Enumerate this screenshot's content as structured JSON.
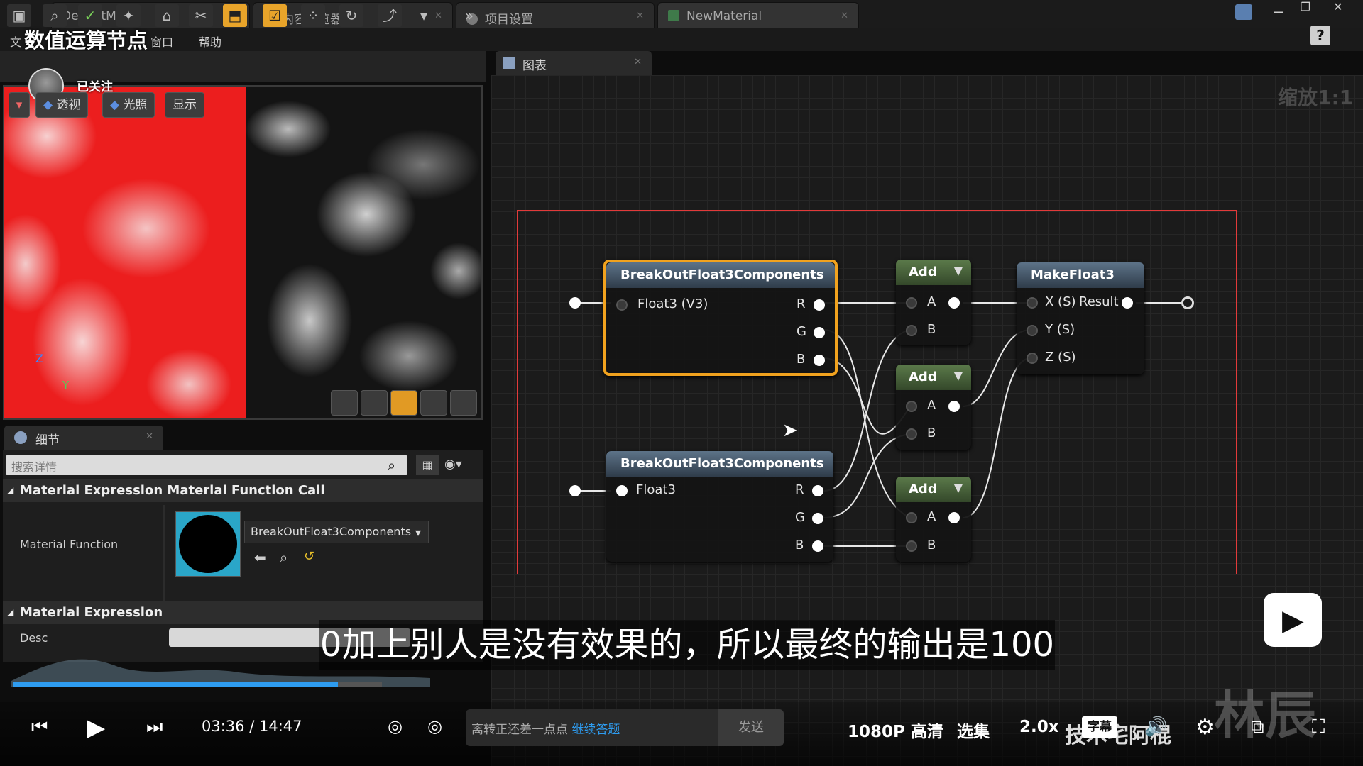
{
  "app": {
    "logo": "u"
  },
  "tabs": [
    {
      "label": "DefaultMap"
    },
    {
      "label": "内容浏览器"
    },
    {
      "label": "项目设置"
    },
    {
      "label": "NewMaterial"
    }
  ],
  "menu": {
    "file": "文",
    "window": "窗口",
    "help": "帮助"
  },
  "video": {
    "title": "数值运算节点",
    "followed": "已关注",
    "subtitle": "0加上别人是没有效果的，所以最终的输出是100",
    "current_time": "03:36",
    "separator": "/",
    "total_time": "14:47",
    "progress": 0.243,
    "danmu_prompt": "离转正还差一点点",
    "danmu_link": "继续答题",
    "send": "发送",
    "quality": "1080P 高清",
    "episodes": "选集",
    "speed": "2.0x",
    "subtitles_btn": "字幕",
    "uploader_text": "技术宅阿棍",
    "watermark": "林辰"
  },
  "viewport": {
    "buttons": [
      {
        "label": "透视"
      },
      {
        "label": "光照"
      },
      {
        "label": "显示"
      }
    ],
    "axis_z": "Z",
    "axis_y": "Y"
  },
  "details": {
    "tab": "细节",
    "search_placeholder": "搜索详情",
    "section1": "Material Expression Material Function Call",
    "mf_label": "Material Function",
    "mf_value": "BreakOutFloat3Components",
    "section2": "Material Expression",
    "desc_label": "Desc"
  },
  "graph": {
    "tab": "图表",
    "zoom": "缩放1:1",
    "nodes": {
      "bo1": {
        "title": "BreakOutFloat3Components",
        "input": "Float3 (V3)",
        "r": "R",
        "g": "G",
        "b": "B"
      },
      "bo2": {
        "title": "BreakOutFloat3Components",
        "input": "Float3",
        "r": "R",
        "g": "G",
        "b": "B"
      },
      "add1": {
        "title": "Add",
        "a": "A",
        "b": "B"
      },
      "add2": {
        "title": "Add",
        "a": "A",
        "b": "B"
      },
      "add3": {
        "title": "Add",
        "a": "A",
        "b": "B"
      },
      "mk": {
        "title": "MakeFloat3",
        "x": "X (S)",
        "result": "Result",
        "y": "Y (S)",
        "z": "Z (S)"
      }
    }
  },
  "colors": {
    "accent": "#f1a21e",
    "selection": "#e23a3a",
    "progress": "#2e9cf0"
  }
}
